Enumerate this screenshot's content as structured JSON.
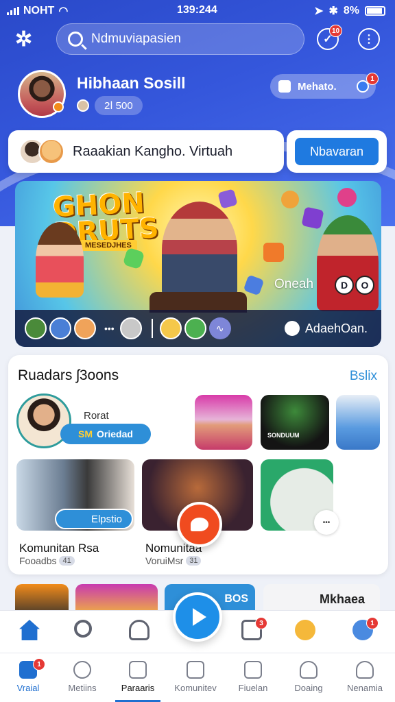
{
  "status_bar": {
    "carrier": "NOHT",
    "time": "139:244",
    "battery": "8%"
  },
  "search": {
    "placeholder": "Ndmuviapasien"
  },
  "header": {
    "notif_count": "10",
    "menu_icon": "more-vertical-icon"
  },
  "profile": {
    "name": "Hibhaan Sosill",
    "stat": "2ⅼ 500",
    "frame_label": "Mehato.",
    "frame_badge": "1"
  },
  "virtual_room": {
    "title": "Raaakian Kangho. Virtuah",
    "button": "Nbavaran"
  },
  "banner": {
    "title_line1": "GHON",
    "title_line2": "DRUTS",
    "subtitle": "MESEDJHES",
    "host_label": "Oneah",
    "btn_a": "D",
    "btn_b": "O",
    "more": "•••",
    "chat_label": "AdaehOan."
  },
  "recommendations": {
    "heading": "Ruadars ʃ3oons",
    "see_all": "Bslix",
    "profile_tag_bold": "SM",
    "profile_tag": "Oriedad",
    "profile_top": "Rorat",
    "concert_label": "SONDUUM",
    "chip": "Elpstio",
    "more_dots": "•••",
    "items": [
      {
        "title": "Komunitan Rsa",
        "sub": "Fooadbs",
        "count": "41"
      },
      {
        "title": "Nomunitaa",
        "sub": "VoruiMsr",
        "count": "31"
      }
    ]
  },
  "strip": {
    "label1": "BOS",
    "label2": "Mkhaea"
  },
  "nav_actions": {
    "notif": "3",
    "profile_badge": "1"
  },
  "tabs": [
    {
      "label": "Vraial",
      "badge": "1"
    },
    {
      "label": "Metiins"
    },
    {
      "label": "Paraaris"
    },
    {
      "label": "Komunitev"
    },
    {
      "label": "Fiuelan"
    },
    {
      "label": "Doaing"
    },
    {
      "label": "Nenamia"
    }
  ],
  "colors": {
    "primary": "#1f7ae0",
    "hero": "#3557dc",
    "accent": "#f04b1f",
    "badge": "#e53935"
  }
}
